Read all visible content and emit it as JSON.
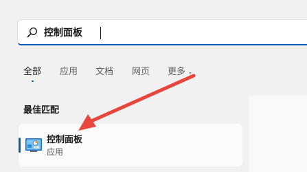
{
  "search": {
    "value": "控制面板",
    "icon": "search-icon"
  },
  "tabs": [
    {
      "label": "全部",
      "active": true
    },
    {
      "label": "应用",
      "active": false
    },
    {
      "label": "文档",
      "active": false
    },
    {
      "label": "网页",
      "active": false
    },
    {
      "label": "更多",
      "active": false
    }
  ],
  "best_match": {
    "section_title": "最佳匹配",
    "item": {
      "title": "控制面板",
      "subtitle": "应用",
      "icon": "control-panel-icon"
    }
  },
  "colors": {
    "accent": "#005fb8",
    "annotation_arrow": "#e8453c",
    "background": "#f1f1f1"
  }
}
